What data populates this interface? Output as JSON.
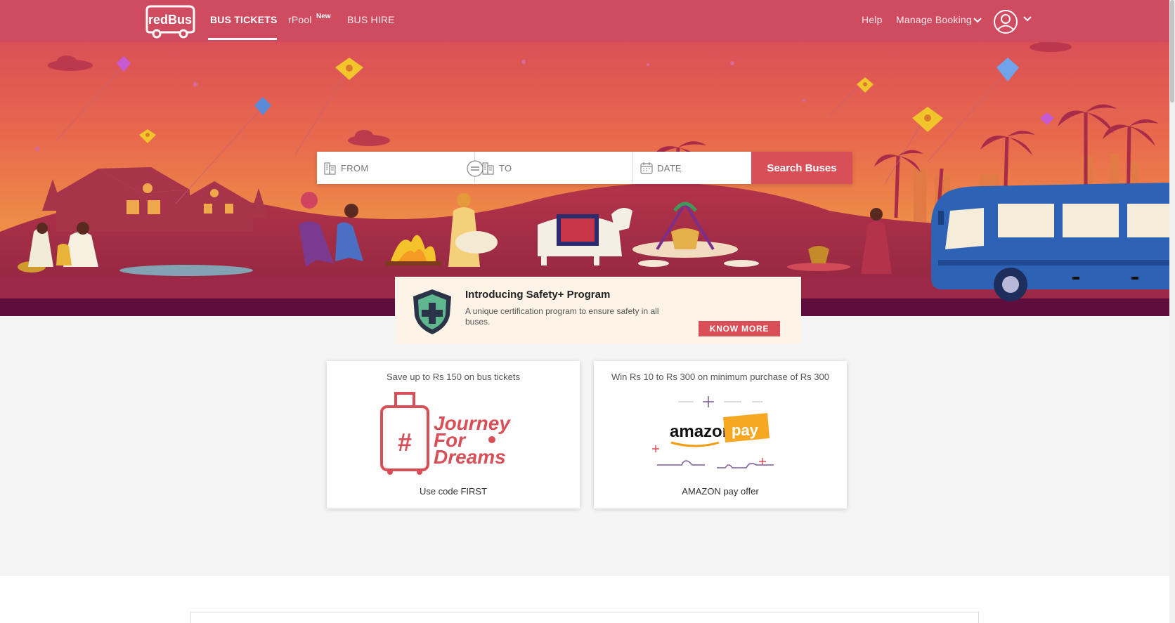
{
  "header": {
    "logo_text": "redBus",
    "nav": {
      "bus_tickets": "BUS TICKETS",
      "rpool": "rPool",
      "rpool_badge": "New",
      "bus_hire": "BUS HIRE",
      "help": "Help",
      "manage_booking": "Manage Booking"
    },
    "icons": {
      "manage_chevron": "chevron-down-icon",
      "profile": "user-circle-icon",
      "profile_chevron": "chevron-down-icon"
    }
  },
  "search": {
    "from_placeholder": "FROM",
    "to_placeholder": "TO",
    "date_placeholder": "DATE",
    "button_label": "Search Buses",
    "icons": {
      "from": "city-building-icon",
      "to": "city-building-icon",
      "swap": "swap-icon",
      "date": "calendar-icon"
    }
  },
  "safety": {
    "title": "Introducing Safety+ Program",
    "description": "A unique certification program to ensure safety in all buses.",
    "button": "KNOW MORE",
    "icon": "shield-plus-icon"
  },
  "offers": [
    {
      "headline": "Save up to Rs 150 on bus tickets",
      "art_text": [
        "Journey",
        "For",
        "Dreams"
      ],
      "art_symbol": "#",
      "footer": "Use code FIRST"
    },
    {
      "headline": "Win Rs 10 to Rs 300 on minimum purchase of Rs 300",
      "art_text": [
        "amazon",
        "pay"
      ],
      "footer": "AMAZON pay offer"
    }
  ],
  "colors": {
    "brand": "#d84f57",
    "header": "#cf4b5f",
    "hero_sky_top": "#d94c5a",
    "hero_sky_bottom": "#f2b440",
    "ground": "#8a1f3a",
    "safety_bg": "#fdf4e7"
  }
}
